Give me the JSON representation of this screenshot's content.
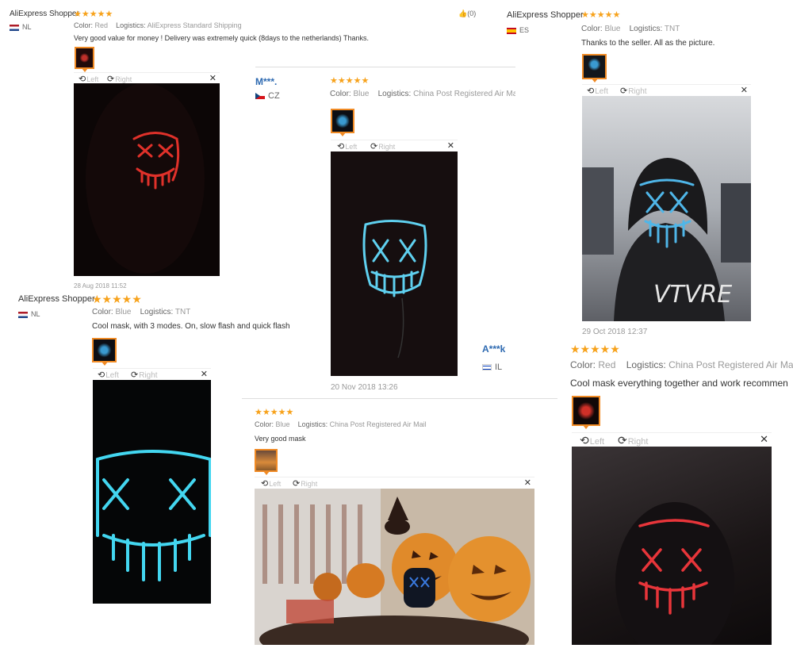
{
  "labels": {
    "color": "Color:",
    "logistics": "Logistics:",
    "left": "Left",
    "right": "Right",
    "close": "✕"
  },
  "reviews": [
    {
      "name": "AliExpress Shopper",
      "stars": "★★★★★",
      "country": "NL",
      "color": "Red",
      "logistics": "AliExpress Standard Shipping",
      "text": "Very good value for money ! Delivery was extremely quick (8days to the netherlands) Thanks.",
      "date": "28 Aug 2018 11:52",
      "likes": "(0)",
      "photo_tone": "red"
    },
    {
      "name": "AliExpress Shopper",
      "stars": "★★★★★",
      "country": "ES",
      "color": "Blue",
      "logistics": "TNT",
      "text": "Thanks to the seller. All as the picture.",
      "date": "29 Oct 2018 12:37",
      "photo_tone": "blue"
    },
    {
      "name": "M***.",
      "stars": "★★★★★",
      "country": "CZ",
      "color": "Blue",
      "logistics": "China Post Registered Air Mai",
      "text": "",
      "date": "20 Nov 2018 13:26",
      "photo_tone": "blue"
    },
    {
      "name": "AliExpress Shopper",
      "stars": "★★★★★",
      "country": "NL",
      "color": "Blue",
      "logistics": "TNT",
      "text": "Cool mask, with 3 modes. On, slow flash and quick flash",
      "photo_tone": "blue"
    },
    {
      "name": "A***k",
      "stars": "★★★★★",
      "country": "IL",
      "color": "Red",
      "logistics": "China Post Registered Air Mail",
      "text": "Cool mask everything together and work recommen",
      "photo_tone": "red"
    },
    {
      "name": "",
      "stars": "★★★★★",
      "country": "",
      "color": "Blue",
      "logistics": "China Post Registered Air Mail",
      "text": "Very good mask",
      "photo_tone": "halloween"
    }
  ],
  "icons": {
    "like": "thumbs-up-icon",
    "rotate_left": "rotate-left-icon",
    "rotate_right": "rotate-right-icon",
    "close": "close-icon"
  },
  "colors": {
    "star": "#f7a21b",
    "thumb_border": "#f08a24",
    "buyer_name_link": "#2e6ab1"
  }
}
